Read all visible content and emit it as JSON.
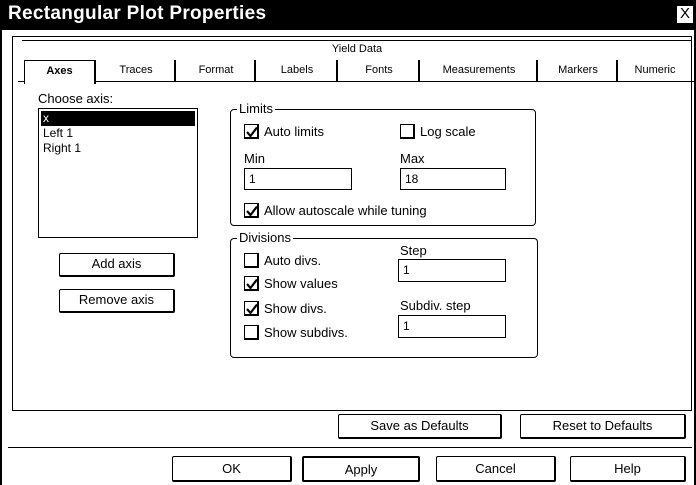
{
  "window": {
    "title": "Rectangular Plot Properties",
    "close_glyph": "X"
  },
  "tabs": {
    "back_row": [
      "Yield Data"
    ],
    "front_row": [
      "Axes",
      "Traces",
      "Format",
      "Labels",
      "Fonts",
      "Measurements",
      "Markers",
      "Numeric"
    ],
    "active": "Axes"
  },
  "choose_axis": {
    "label": "Choose axis:",
    "items": [
      "x",
      "Left 1",
      "Right 1"
    ],
    "selected": "x"
  },
  "axis_buttons": {
    "add": "Add axis",
    "remove": "Remove axis"
  },
  "limits": {
    "legend": "Limits",
    "auto_limits": {
      "label": "Auto limits",
      "checked": true
    },
    "log_scale": {
      "label": "Log scale",
      "checked": false
    },
    "min_label": "Min",
    "min_value": "1",
    "max_label": "Max",
    "max_value": "18",
    "allow_autoscale": {
      "label": "Allow autoscale while tuning",
      "checked": true
    }
  },
  "divisions": {
    "legend": "Divisions",
    "auto_divs": {
      "label": "Auto divs.",
      "checked": false
    },
    "show_values": {
      "label": "Show values",
      "checked": true
    },
    "show_divs": {
      "label": "Show divs.",
      "checked": true
    },
    "show_subdivs": {
      "label": "Show subdivs.",
      "checked": false
    },
    "step_label": "Step",
    "step_value": "1",
    "subdiv_label": "Subdiv. step",
    "subdiv_value": "1"
  },
  "defaults_buttons": {
    "save": "Save as Defaults",
    "reset": "Reset to Defaults"
  },
  "dialog_buttons": {
    "ok": "OK",
    "apply": "Apply",
    "cancel": "Cancel",
    "help": "Help"
  }
}
